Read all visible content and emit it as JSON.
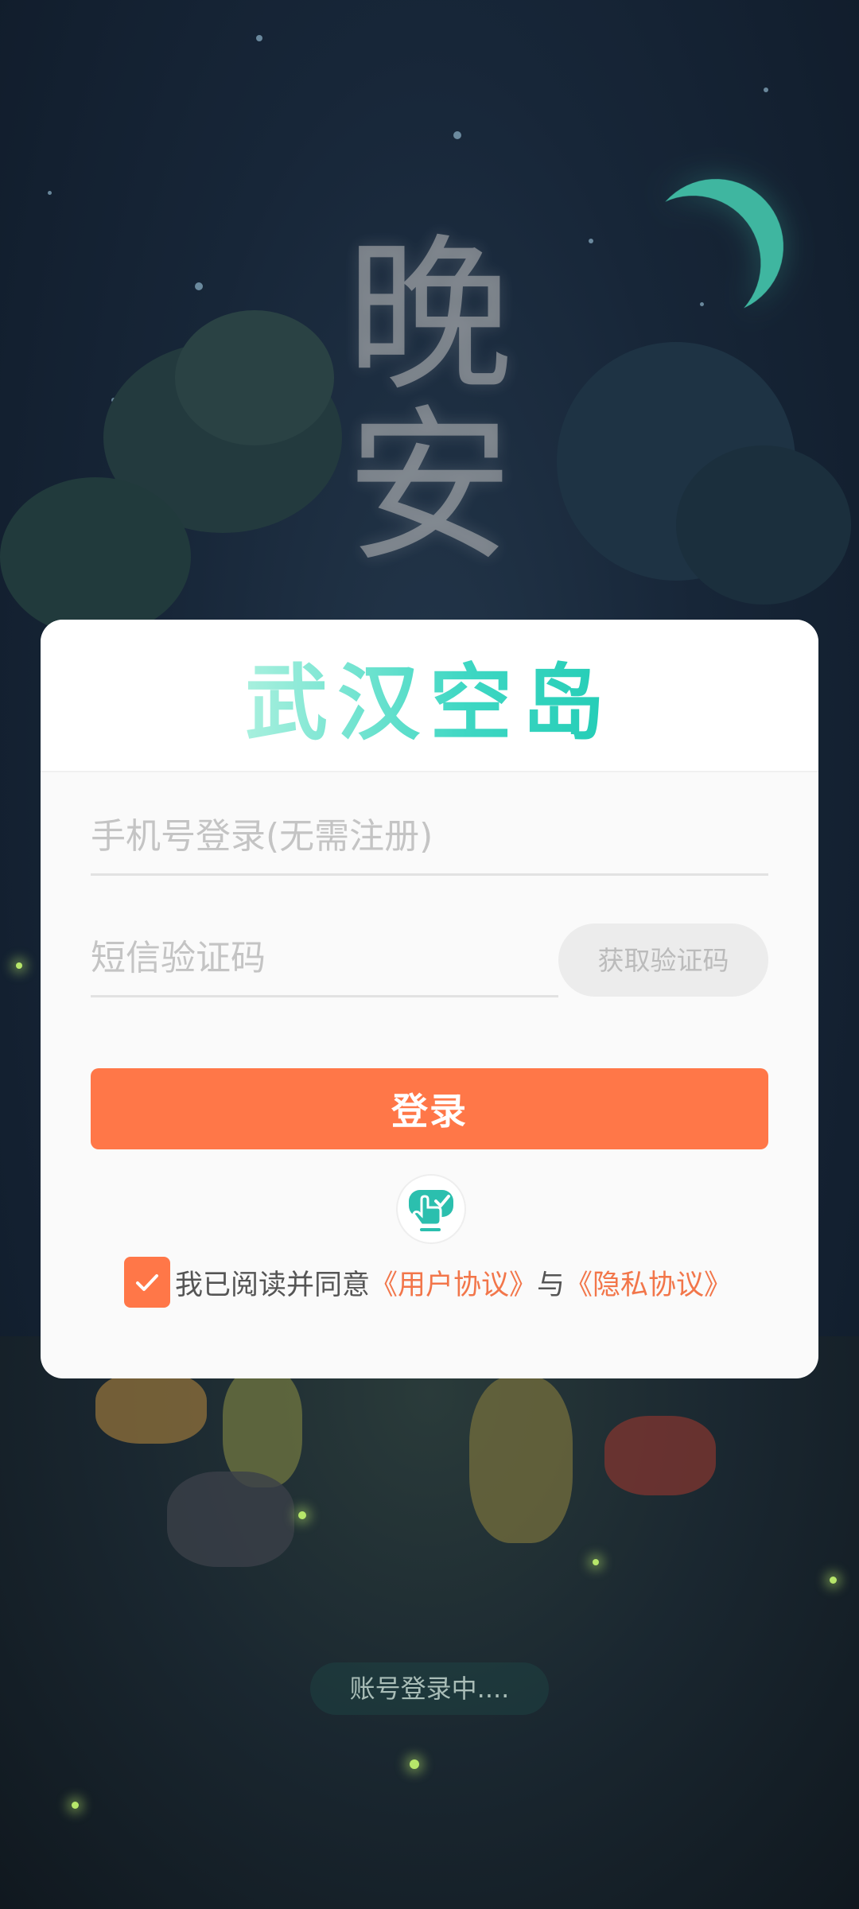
{
  "background": {
    "night_title": "晚安",
    "status_text": "账号登录中...."
  },
  "login_card": {
    "app_title": "武汉空岛",
    "phone": {
      "placeholder": "手机号登录(无需注册)",
      "value": ""
    },
    "sms_code": {
      "placeholder": "短信验证码",
      "value": ""
    },
    "get_code_label": "获取验证码",
    "login_label": "登录",
    "touch_icon": "hand-tap-icon",
    "agreement": {
      "checked": true,
      "prefix": "我已阅读并同意",
      "user_agreement": "《用户协议》",
      "conjunction": "与",
      "privacy_agreement": "《隐私协议》"
    }
  },
  "colors": {
    "accent_orange": "#ff7748",
    "title_teal": "#3ed7c3",
    "link_orange": "#f2764a"
  }
}
